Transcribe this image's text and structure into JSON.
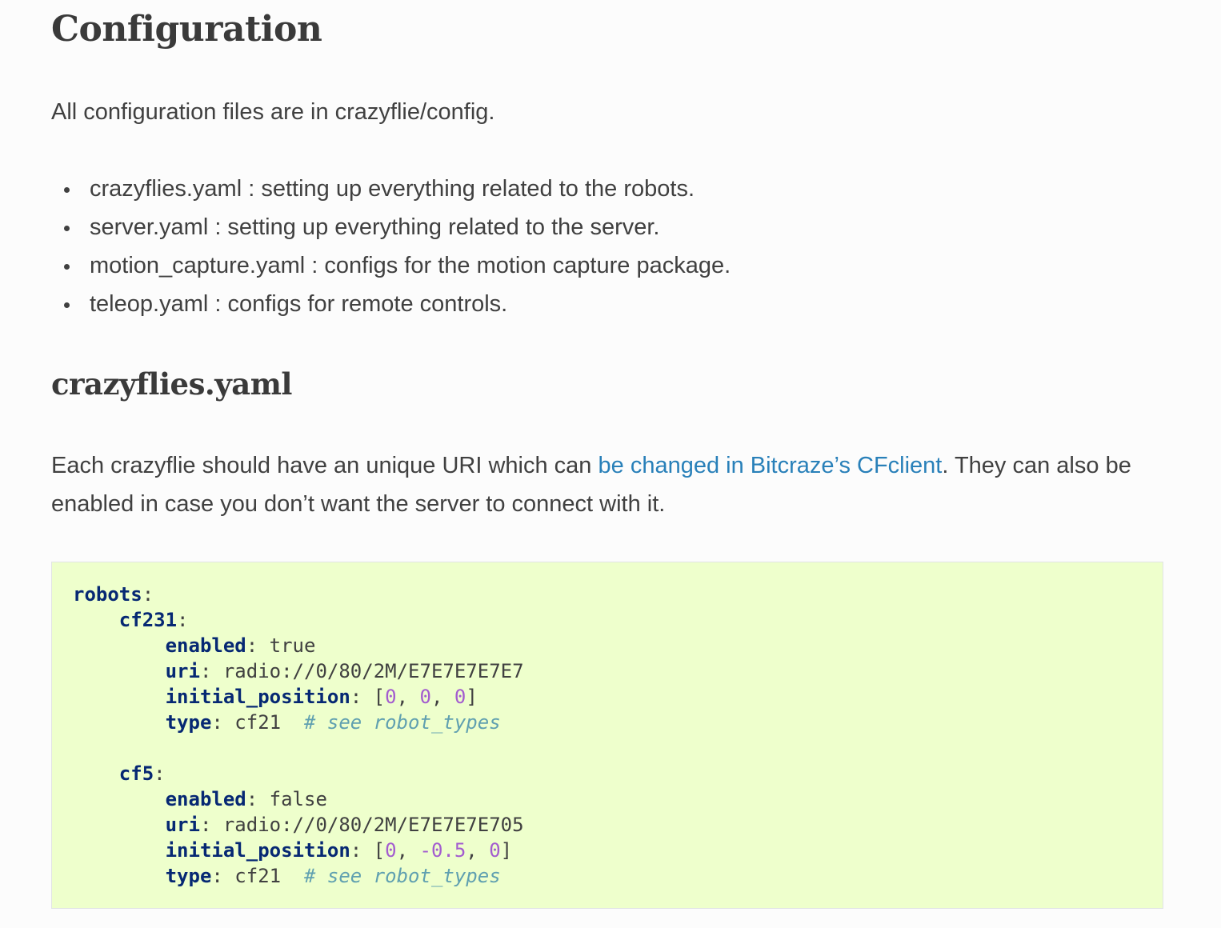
{
  "page": {
    "title": "Configuration",
    "intro_text": "All configuration files are in crazyflie/config.",
    "files": [
      {
        "name": "crazyflies.yaml",
        "desc": " : setting up everything related to the robots."
      },
      {
        "name": "server.yaml",
        "desc": " : setting up everything related to the server."
      },
      {
        "name": "motion_capture.yaml",
        "desc": " : configs for the motion capture package."
      },
      {
        "name": "teleop.yaml",
        "desc": " : configs for remote controls."
      }
    ],
    "section_title": "crazyflies.yaml",
    "section_text_before": "Each crazyflie should have an unique URI which can ",
    "section_link": "be changed in Bitcraze’s CFclient",
    "section_text_after": ". They can also be enabled in case you don’t want the server to connect with it."
  },
  "code": {
    "robots_key": "robots",
    "robots": [
      {
        "name": "cf231",
        "enabled": "true",
        "uri": "radio://0/80/2M/E7E7E7E7E7",
        "position": [
          "0",
          "0",
          "0"
        ],
        "type": "cf21",
        "comment": "# see robot_types"
      },
      {
        "name": "cf5",
        "enabled": "false",
        "uri": "radio://0/80/2M/E7E7E7E705",
        "position": [
          "0",
          "-0.5",
          "0"
        ],
        "type": "cf21",
        "comment": "# see robot_types"
      }
    ],
    "keys": {
      "enabled": "enabled",
      "uri": "uri",
      "initial_position": "initial_position",
      "type": "type"
    }
  },
  "colors": {
    "link": "#2980b9",
    "code_background": "#eeffcc",
    "code_key": "#062873",
    "code_number": "#a35ccf",
    "code_comment": "#60a0b0"
  }
}
